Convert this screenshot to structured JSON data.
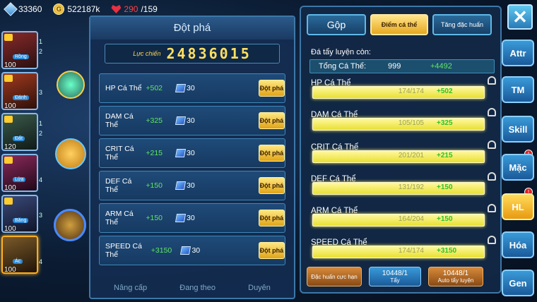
{
  "topbar": {
    "gems": "33360",
    "gold": "522187k",
    "energy_current": "290",
    "energy_max": "/159",
    "gold_icon": "coin-icon"
  },
  "heroes": [
    {
      "level": "100",
      "tag": "Rồng",
      "count": "1",
      "count2": "2"
    },
    {
      "level": "100",
      "tag": "Đánh",
      "count": "3"
    },
    {
      "level": "120",
      "tag": "Đất",
      "count": "1",
      "count2": "2"
    },
    {
      "level": "100",
      "tag": "Lửa",
      "count": "4"
    },
    {
      "level": "100",
      "tag": "Băng",
      "count": "3"
    },
    {
      "level": "100",
      "tag": "Ác",
      "count": "4"
    }
  ],
  "breakthrough": {
    "title": "Đột phá",
    "power_label": "Lực chiến",
    "power_value": "24836015",
    "rows": [
      {
        "name": "HP Cá Thể",
        "plus": "+502",
        "cost": "30",
        "button": "Đột phá"
      },
      {
        "name": "DAM Cá Thể",
        "plus": "+325",
        "cost": "30",
        "button": "Đột phá"
      },
      {
        "name": "CRIT Cá Thể",
        "plus": "+215",
        "cost": "30",
        "button": "Đột phá"
      },
      {
        "name": "DEF Cá Thể",
        "plus": "+150",
        "cost": "30",
        "button": "Đột phá"
      },
      {
        "name": "ARM Cá Thể",
        "plus": "+150",
        "cost": "30",
        "button": "Đột phá"
      },
      {
        "name": "SPEED Cá Thể",
        "plus": "+3150",
        "cost": "30",
        "button": "Đột phá"
      }
    ],
    "bottom": [
      "Nâng cấp",
      "Đang theo",
      "Duyên"
    ]
  },
  "panel": {
    "tabs": [
      "Gộp",
      "Điểm cá thể",
      "Tăng đặc huấn"
    ],
    "remain_label": "Đá tẩy luyện còn:",
    "total_label": "Tổng Cá Thể:",
    "total_value": "999",
    "total_plus": "+4492",
    "stats": [
      {
        "name": "HP Cá Thể",
        "value": "174/174",
        "plus": "+502",
        "fill": 1.0
      },
      {
        "name": "DAM Cá Thể",
        "value": "105/105",
        "plus": "+325",
        "fill": 1.0
      },
      {
        "name": "CRIT Cá Thể",
        "value": "201/201",
        "plus": "+215",
        "fill": 1.0
      },
      {
        "name": "DEF Cá Thể",
        "value": "131/192",
        "plus": "+150",
        "fill": 1.0
      },
      {
        "name": "ARM Cá Thể",
        "value": "164/204",
        "plus": "+150",
        "fill": 1.0
      },
      {
        "name": "SPEED Cá Thể",
        "value": "174/174",
        "plus": "+3150",
        "fill": 1.0
      }
    ],
    "buttons": {
      "special": "Đặc huấn cực hạn",
      "wash_count": "10448/1",
      "wash_label": "Tẩy",
      "auto_count": "10448/1",
      "auto_label": "Auto tẩy luyện"
    }
  },
  "side_menu": [
    "Attr",
    "TM",
    "Skill",
    "Mặc",
    "HL",
    "Hóa",
    "Gen"
  ],
  "side_active": "HL",
  "colors": {
    "gold": "#ffd650",
    "green": "#5fe85f",
    "accent": "#3a9ad8"
  }
}
